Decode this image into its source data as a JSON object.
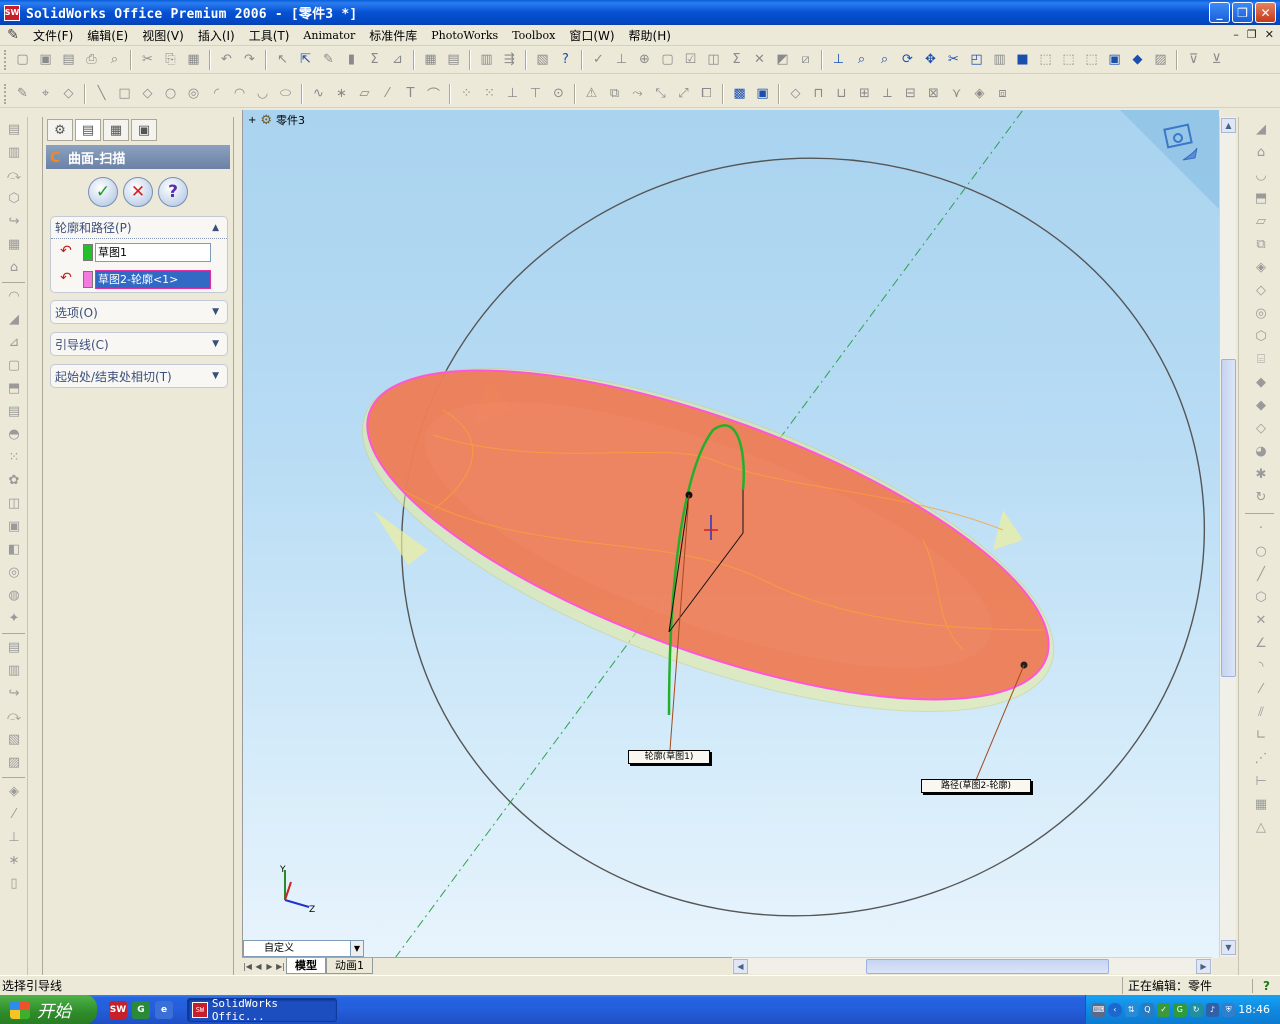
{
  "window": {
    "title": "SolidWorks Office Premium 2006 - [零件3 *]",
    "app_icon": "SW"
  },
  "menu": {
    "items": [
      "文件(F)",
      "编辑(E)",
      "视图(V)",
      "插入(I)",
      "工具(T)",
      "Animator",
      "标准件库",
      "PhotoWorks",
      "Toolbox",
      "窗口(W)",
      "帮助(H)"
    ]
  },
  "feature_tree": {
    "root": "零件3"
  },
  "property_manager": {
    "title": "曲面-扫描",
    "groups": {
      "profile_path": {
        "label": "轮廓和路径(P)",
        "profile_value": "草图1",
        "path_value": "草图2-轮廓<1>",
        "profile_color": "#22c02a",
        "path_color": "#f57ae0"
      },
      "options": {
        "label": "选项(O)"
      },
      "guides": {
        "label": "引导线(C)"
      },
      "tangency": {
        "label": "起始处/结束处相切(T)"
      }
    }
  },
  "viewport": {
    "callout_profile": "轮廓(草图1)",
    "callout_path": "路径(草图2-轮廓)",
    "triad_y": "Y",
    "triad_z": "Z",
    "colors": {
      "surface": "#ee7a55",
      "path_outline": "#ff55dd",
      "profile_curve": "#22b02a",
      "axis_line": "#2ca34a",
      "preview": "#e8e88a"
    }
  },
  "bottom": {
    "view_combo": "自定义",
    "tabs": [
      "模型",
      "动画1"
    ]
  },
  "status": {
    "left": "选择引导线",
    "right": "正在编辑：零件",
    "help": "?"
  },
  "taskbar": {
    "start": "开始",
    "app_button": "SolidWorks Offic...",
    "clock": "18:46"
  }
}
